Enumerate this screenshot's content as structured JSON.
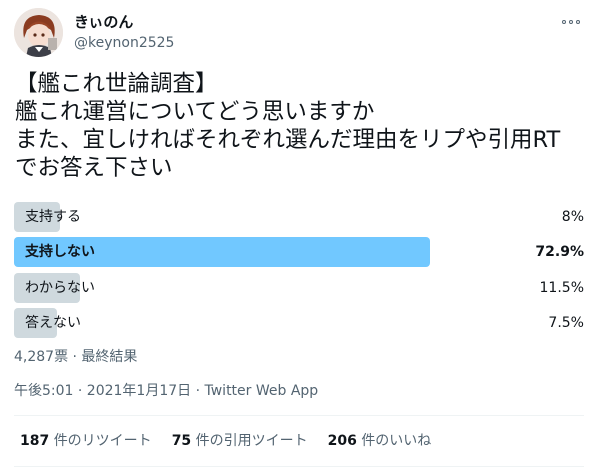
{
  "user": {
    "display_name": "きぃのん",
    "handle": "@keynon2525"
  },
  "tweet": {
    "text": "【艦これ世論調査】\n艦これ運営についてどう思いますか\nまた、宜しければそれぞれ選んだ理由をリプや引用RT\nでお答え下さい"
  },
  "poll": {
    "options": [
      {
        "label": "支持する",
        "percent_text": "8%",
        "percent": 8
      },
      {
        "label": "支持しない",
        "percent_text": "72.9%",
        "percent": 72.9
      },
      {
        "label": "わからない",
        "percent_text": "11.5%",
        "percent": 11.5
      },
      {
        "label": "答えない",
        "percent_text": "7.5%",
        "percent": 7.5
      }
    ],
    "summary": "4,287票 · 最終結果",
    "bar_color": "#cfd9de",
    "winner_color": "#71c8ff"
  },
  "meta": {
    "timestamp": "午後5:01 · 2021年1月17日 · Twitter Web App"
  },
  "stats": {
    "retweets_count": "187",
    "retweets_label": "件のリツイート",
    "quotes_count": "75",
    "quotes_label": "件の引用ツイート",
    "likes_count": "206",
    "likes_label": "件のいいね"
  },
  "icons": {
    "more": "more-icon",
    "avatar": "anime-character-avatar"
  }
}
